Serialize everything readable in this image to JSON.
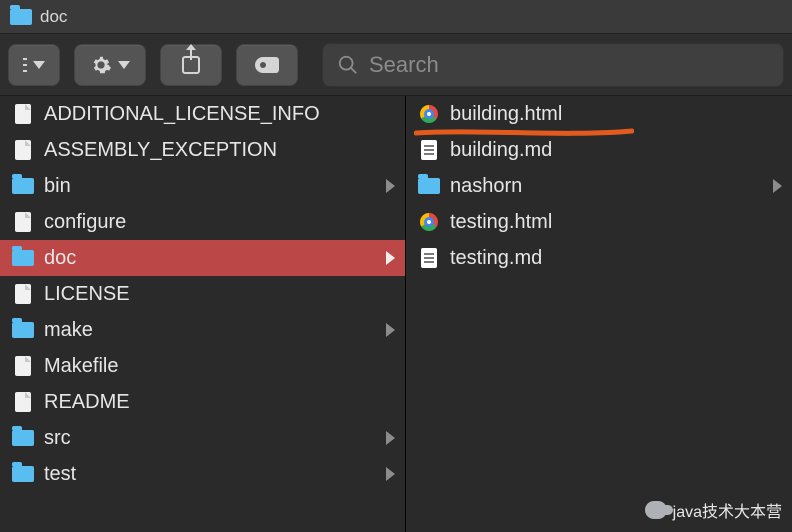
{
  "title": "doc",
  "search": {
    "placeholder": "Search"
  },
  "left_items": [
    {
      "name": "ADDITIONAL_LICENSE_INFO",
      "icon": "doc",
      "folder": false,
      "selected": false
    },
    {
      "name": "ASSEMBLY_EXCEPTION",
      "icon": "doc",
      "folder": false,
      "selected": false
    },
    {
      "name": "bin",
      "icon": "folder",
      "folder": true,
      "selected": false
    },
    {
      "name": "configure",
      "icon": "doc",
      "folder": false,
      "selected": false
    },
    {
      "name": "doc",
      "icon": "folder",
      "folder": true,
      "selected": true
    },
    {
      "name": "LICENSE",
      "icon": "doc",
      "folder": false,
      "selected": false
    },
    {
      "name": "make",
      "icon": "folder",
      "folder": true,
      "selected": false
    },
    {
      "name": "Makefile",
      "icon": "doc",
      "folder": false,
      "selected": false
    },
    {
      "name": "README",
      "icon": "doc",
      "folder": false,
      "selected": false
    },
    {
      "name": "src",
      "icon": "folder",
      "folder": true,
      "selected": false
    },
    {
      "name": "test",
      "icon": "folder",
      "folder": true,
      "selected": false
    }
  ],
  "right_items": [
    {
      "name": "building.html",
      "icon": "chrome",
      "folder": false,
      "highlight": true
    },
    {
      "name": "building.md",
      "icon": "md",
      "folder": false
    },
    {
      "name": "nashorn",
      "icon": "folder",
      "folder": true
    },
    {
      "name": "testing.html",
      "icon": "chrome",
      "folder": false
    },
    {
      "name": "testing.md",
      "icon": "md",
      "folder": false
    }
  ],
  "watermark": "java技术大本营"
}
